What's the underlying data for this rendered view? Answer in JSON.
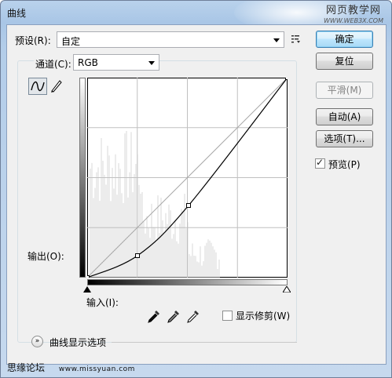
{
  "window": {
    "title": "曲线"
  },
  "watermark_top": {
    "line1": "网页教学网",
    "line2": "WWW.WEB3X.COM"
  },
  "preset": {
    "label": "预设(R):",
    "value": "自定",
    "menu_icon": "list-menu-icon"
  },
  "channel": {
    "label": "通道(C):",
    "value": "RGB"
  },
  "buttons": {
    "ok": "确定",
    "reset": "复位",
    "smooth": "平滑(M)",
    "auto": "自动(A)",
    "options": "选项(T)..."
  },
  "preview": {
    "label": "预览(P)",
    "checked": true
  },
  "output_label": "输出(O):",
  "input_label": "输入(I):",
  "show_clipping": {
    "label": "显示修剪(W)",
    "checked": false
  },
  "curve_display_options": {
    "label": "曲线显示选项"
  },
  "watermark_bottom": {
    "text": "思缘论坛",
    "url": "www.missyuan.com"
  },
  "tools": [
    "curve-point-tool-icon",
    "pencil-icon"
  ],
  "eyedroppers": [
    "black-eyedropper-icon",
    "gray-eyedropper-icon",
    "white-eyedropper-icon"
  ],
  "curve": {
    "control_points": [
      [
        0,
        0
      ],
      [
        64,
        28
      ],
      [
        129,
        92
      ],
      [
        255,
        255
      ]
    ],
    "range": [
      0,
      255
    ]
  }
}
